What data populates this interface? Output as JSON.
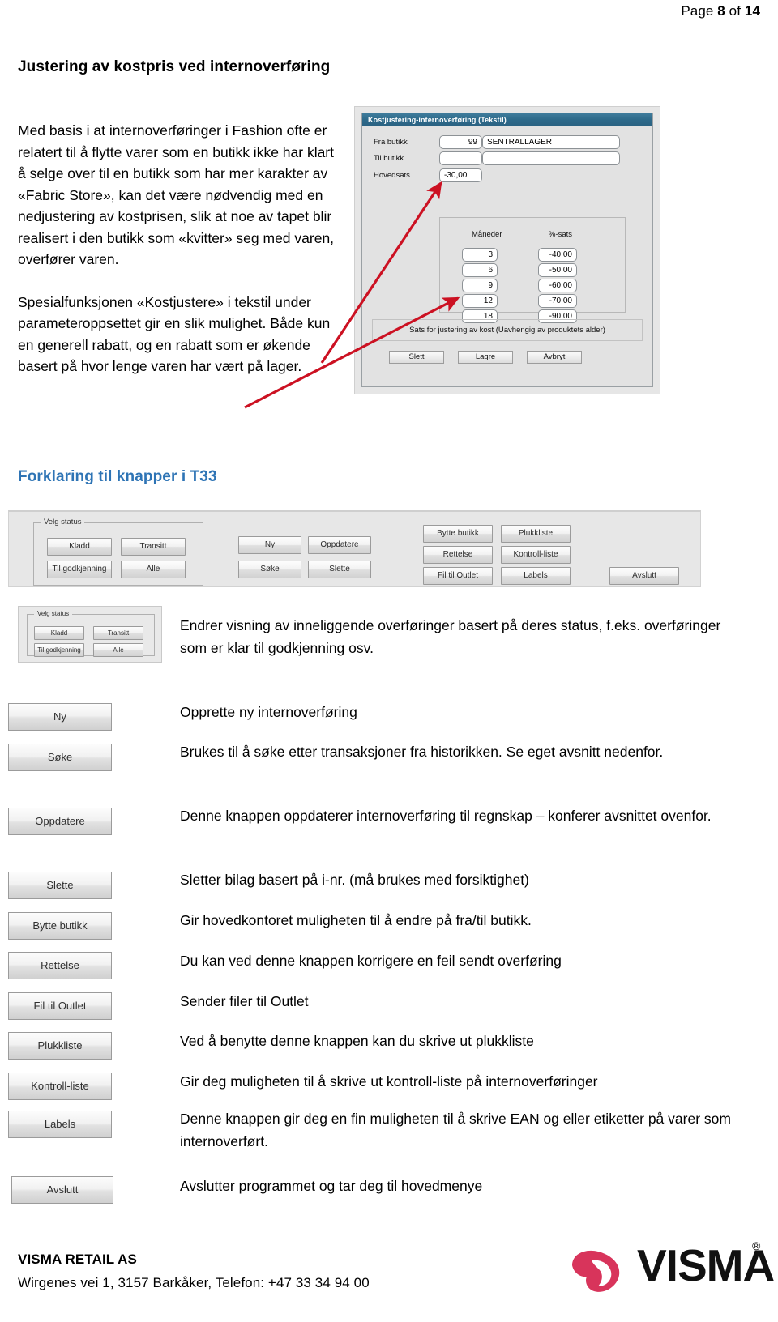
{
  "header": {
    "page_prefix": "Page",
    "page_number": "8",
    "page_of": "of",
    "page_total": "14"
  },
  "doc_title": "Justering av kostpris ved internoverføring",
  "intro": {
    "paragraph1": "Med basis i at internoverføringer i Fashion ofte er relatert til å flytte varer som en butikk ikke har klart å selge over til en butikk som har mer karakter av «Fabric Store», kan det være nødvendig med en nedjustering av kostprisen, slik at noe av tapet blir realisert i den butikk som «kvitter» seg med varen, overfører varen.",
    "paragraph2": "Spesialfunksjonen «Kostjustere» i tekstil under parameteroppsettet gir en slik mulighet. Både kun en generell rabatt, og en rabatt som er økende basert på hvor lenge varen har vært på lager."
  },
  "dialog": {
    "title": "Kostjustering-internoverføring (Tekstil)",
    "fields": [
      {
        "label": "Fra butikk",
        "value": "99",
        "name_value": "SENTRALLAGER"
      },
      {
        "label": "Til butikk",
        "value": "",
        "name_value": ""
      },
      {
        "label": "Hovedsats",
        "value": "-30,00"
      }
    ],
    "rate_table": {
      "col_months": "Måneder",
      "col_rate": "%-sats",
      "rows": [
        {
          "months": "3",
          "rate": "-40,00"
        },
        {
          "months": "6",
          "rate": "-50,00"
        },
        {
          "months": "9",
          "rate": "-60,00"
        },
        {
          "months": "12",
          "rate": "-70,00"
        },
        {
          "months": "18",
          "rate": "-90,00"
        }
      ]
    },
    "info_text": "Sats for justering av kost (Uavhengig av produktets alder)",
    "buttons": {
      "delete": "Slett",
      "save": "Lagre",
      "cancel": "Avbryt"
    }
  },
  "section_title": "Forklaring til knapper i T33",
  "toolbar": {
    "group_legend": "Velg status",
    "status_buttons": [
      "Kladd",
      "Transitt",
      "Til godkjenning",
      "Alle"
    ],
    "action_buttons": [
      "Ny",
      "Oppdatere",
      "Søke",
      "Slette"
    ],
    "right_buttons": [
      "Bytte butikk",
      "Plukkliste",
      "Rettelse",
      "Kontroll-liste",
      "Fil til Outlet",
      "Labels"
    ],
    "exit_button": "Avslutt"
  },
  "explanations": [
    {
      "kind": "panel",
      "button": "Velg status",
      "text": "Endrer visning av inneliggende overføringer basert på deres status, f.eks. overføringer som er klar til godkjenning osv."
    },
    {
      "kind": "button",
      "button": "Ny",
      "text": "Opprette ny internoverføring"
    },
    {
      "kind": "button",
      "button": "Søke",
      "text": "Brukes til å søke etter transaksjoner fra historikken. Se eget avsnitt nedenfor."
    },
    {
      "kind": "button",
      "button": "Oppdatere",
      "text": "Denne knappen oppdaterer internoverføring til regnskap – konferer avsnittet ovenfor."
    },
    {
      "kind": "button",
      "button": "Slette",
      "text": "Sletter bilag basert på i-nr. (må brukes med forsiktighet)"
    },
    {
      "kind": "button",
      "button": "Bytte butikk",
      "text": "Gir hovedkontoret muligheten til å endre på fra/til butikk."
    },
    {
      "kind": "button",
      "button": "Rettelse",
      "text": "Du kan ved denne knappen korrigere en feil sendt overføring"
    },
    {
      "kind": "button",
      "button": "Fil til Outlet",
      "text": "Sender filer til Outlet"
    },
    {
      "kind": "button",
      "button": "Plukkliste",
      "text": "Ved å benytte denne knappen kan du skrive ut plukkliste"
    },
    {
      "kind": "button",
      "button": "Kontroll-liste",
      "text": "Gir deg muligheten til å skrive ut kontroll-liste på internoverføringer"
    },
    {
      "kind": "button",
      "button": "Labels",
      "text": "Denne knappen gir deg en fin muligheten til å skrive EAN og eller etiketter på varer som internoverført."
    },
    {
      "kind": "button",
      "button": "Avslutt",
      "text": "Avslutter programmet og tar deg til hovedmenye"
    }
  ],
  "footer": {
    "company": "VISMA RETAIL AS",
    "address": "Wirgenes vei 1, 3157 Barkåker, Telefon: +47 33 34 94 00",
    "logo_text": "VISMA",
    "logo_reg": "®"
  },
  "colors": {
    "section_heading": "#2e74b5",
    "dialog_titlebar": "#2e6b8b",
    "arrow_red": "#cc1122",
    "visma_mark": "#d8345b"
  }
}
